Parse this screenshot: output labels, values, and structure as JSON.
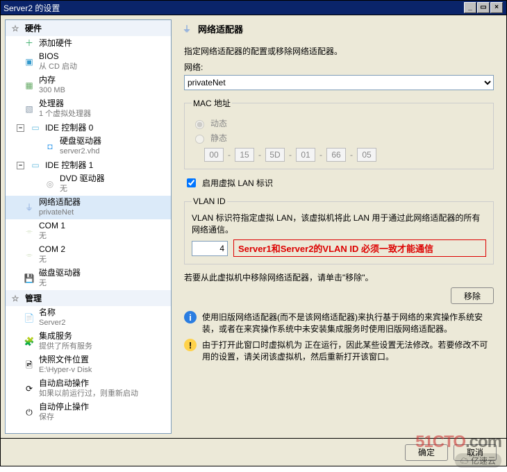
{
  "window": {
    "title": "Server2 的设置",
    "min": "_",
    "max": "▭",
    "close": "×"
  },
  "sections": {
    "hardware": "硬件",
    "management": "管理"
  },
  "hw": {
    "add": "添加硬件",
    "bios": "BIOS",
    "bios_sub": "从 CD 启动",
    "mem": "内存",
    "mem_sub": "300 MB",
    "cpu": "处理器",
    "cpu_sub": "1 个虚拟处理器",
    "ide0": "IDE 控制器 0",
    "hdd": "硬盘驱动器",
    "hdd_sub": "server2.vhd",
    "ide1": "IDE 控制器 1",
    "dvd": "DVD 驱动器",
    "dvd_sub": "无",
    "net": "网络适配器",
    "net_sub": "privateNet",
    "com1": "COM 1",
    "com1_sub": "无",
    "com2": "COM 2",
    "com2_sub": "无",
    "floppy": "磁盘驱动器",
    "floppy_sub": "无"
  },
  "mgmt": {
    "name": "名称",
    "name_sub": "Server2",
    "svc": "集成服务",
    "svc_sub": "提供了所有服务",
    "snap": "快照文件位置",
    "snap_sub": "E:\\Hyper-v Disk",
    "autostart": "自动启动操作",
    "autostart_sub": "如果以前运行过，则重新启动",
    "autostop": "自动停止操作",
    "autostop_sub": "保存"
  },
  "content": {
    "title": "网络适配器",
    "intro": "指定网络适配器的配置或移除网络适配器。",
    "net_label": "网络:",
    "net_value": "privateNet",
    "mac_legend": "MAC 地址",
    "mac_dynamic": "动态",
    "mac_static": "静态",
    "mac": [
      "00",
      "15",
      "5D",
      "01",
      "66",
      "05"
    ],
    "enable_vlan": "启用虚拟 LAN 标识",
    "vlan_legend": "VLAN ID",
    "vlan_desc": "VLAN 标识符指定虚拟 LAN，该虚拟机将此 LAN 用于通过此网络适配器的所有网络通信。",
    "vlan_value": "4",
    "vlan_note": "Server1和Server2的VLAN ID 必须一致才能通信",
    "remove_hint": "若要从此虚拟机中移除网络适配器，请单击\"移除\"。",
    "remove_btn": "移除",
    "info1": "使用旧版网络适配器(而不是该网络适配器)来执行基于网络的来宾操作系统安装，或者在来宾操作系统中未安装集成服务时使用旧版网络适配器。",
    "warn1": "由于打开此窗口时虚拟机为 正在运行，因此某些设置无法修改。若要修改不可用的设置，请关闭该虚拟机，然后重新打开该窗口。"
  },
  "footer": {
    "ok": "确定",
    "cancel": "取消"
  },
  "watermark": {
    "site1": "51CTO",
    "site2": ".com",
    "tag": "☁ 亿速云"
  }
}
